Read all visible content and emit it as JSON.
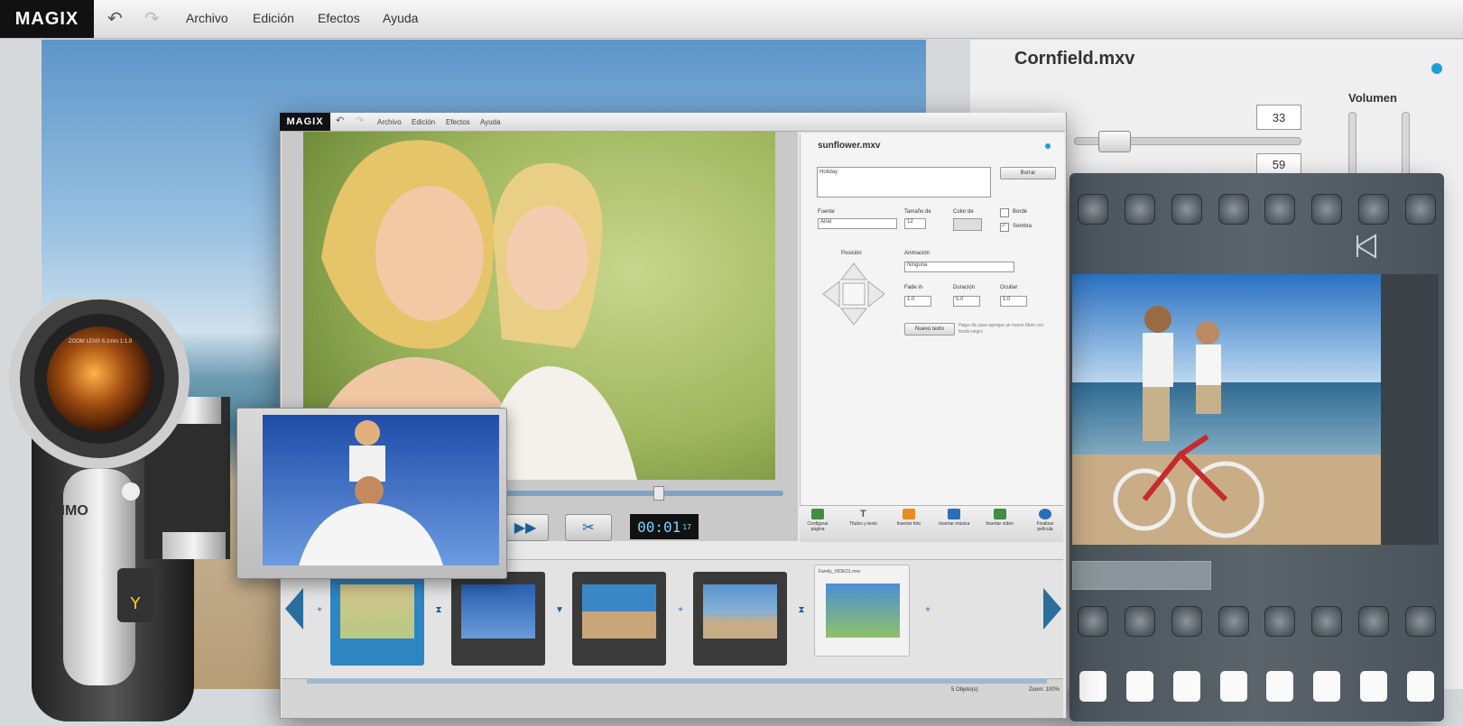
{
  "background_app": {
    "logo": "MAGIX",
    "menu": [
      "Archivo",
      "Edición",
      "Efectos",
      "Ayuda"
    ],
    "file_title": "Cornfield.mxv",
    "volume_label": "Volumen",
    "value_1": "33",
    "value_2": "59"
  },
  "main_window": {
    "logo": "MAGIX",
    "menu": [
      "Archivo",
      "Edición",
      "Efectos",
      "Ayuda"
    ],
    "timecode": "00:01",
    "timecode_frames": "17",
    "text_panel": {
      "title": "sunflower.mxv",
      "textarea_value": "Holiday",
      "delete_button": "Borrar",
      "font_label": "Fuente",
      "font_value": "Arial",
      "size_label": "Tamaño de",
      "size_value": "12",
      "color_label": "Color de",
      "border_label": "Borde",
      "shadow_label": "Sombra",
      "position_label": "Posición",
      "animation_label": "Animación",
      "animation_value": "Ninguna",
      "fade_in_label": "Fade in",
      "fade_in_value": "1.0",
      "duration_label": "Duración",
      "duration_value": "5.0",
      "hide_label": "Ocultar",
      "hide_value": "1.0",
      "new_title_button": "Nuevo texto",
      "hint": "Haga clic para agregar un nuevo título con fondo negro"
    },
    "toolbar": [
      {
        "label": "Configurar página",
        "color": "#3e8f43"
      },
      {
        "label": "Títulos y texto",
        "color": "#555555"
      },
      {
        "label": "Insertar foto",
        "color": "#e88d1f"
      },
      {
        "label": "Insertar música",
        "color": "#2c6fb9"
      },
      {
        "label": "Insertar vídeo",
        "color": "#3e8f43"
      },
      {
        "label": "Finalizar película",
        "color": "#2c6fb9"
      }
    ],
    "timeline": {
      "last_clip_title": "Family_VIDEO1.mxv",
      "status": "5 Objeto(s)",
      "zoom": "Zoom: 100%"
    }
  },
  "camcorder": {
    "brand": "HIMO",
    "lens_text": "ZOOM LENS 6.1mm 1:1.8"
  },
  "colors": {
    "accent_blue": "#1e9fd8",
    "timecode_text": "#7fd3ff",
    "selection": "#2d85c2"
  }
}
